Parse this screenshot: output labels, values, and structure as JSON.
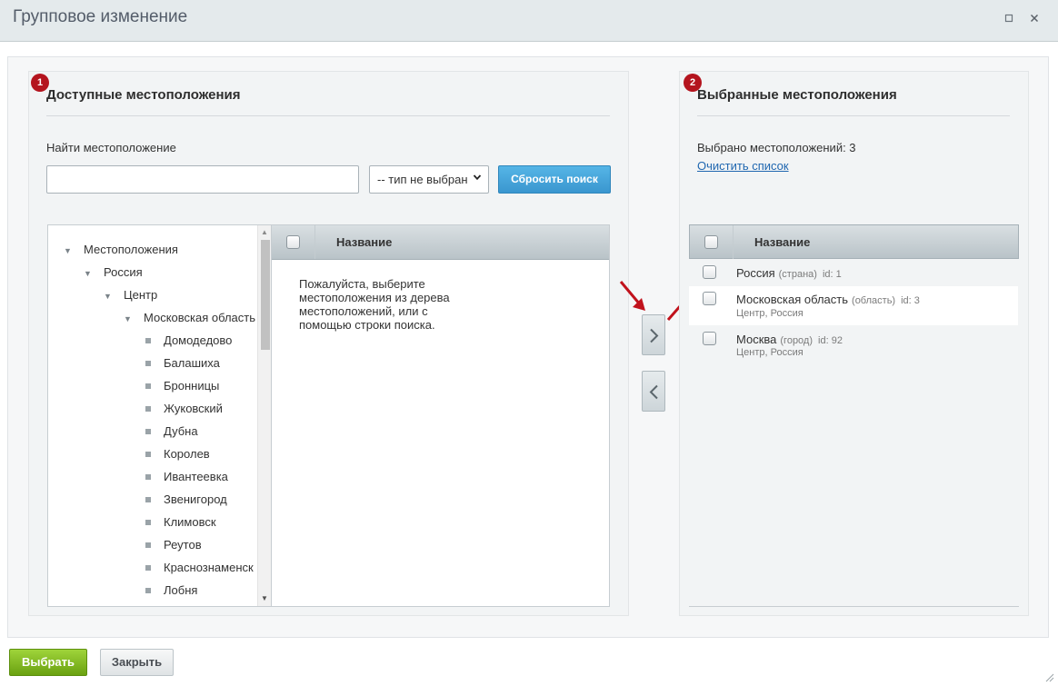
{
  "dialog": {
    "title": "Групповое изменение"
  },
  "available": {
    "badge": "1",
    "title": "Доступные местоположения",
    "search_label": "Найти местоположение",
    "search_value": "",
    "type_select": "-- тип не выбран",
    "reset_button": "Сбросить поиск",
    "tree": [
      {
        "label": "Местоположения",
        "level": 0,
        "kind": "folder"
      },
      {
        "label": "Россия",
        "level": 1,
        "kind": "folder"
      },
      {
        "label": "Центр",
        "level": 2,
        "kind": "folder"
      },
      {
        "label": "Московская область",
        "level": 3,
        "kind": "folder"
      },
      {
        "label": "Домодедово",
        "level": 4,
        "kind": "leaf"
      },
      {
        "label": "Балашиха",
        "level": 4,
        "kind": "leaf"
      },
      {
        "label": "Бронницы",
        "level": 4,
        "kind": "leaf"
      },
      {
        "label": "Жуковский",
        "level": 4,
        "kind": "leaf"
      },
      {
        "label": "Дубна",
        "level": 4,
        "kind": "leaf"
      },
      {
        "label": "Королев",
        "level": 4,
        "kind": "leaf"
      },
      {
        "label": "Ивантеевка",
        "level": 4,
        "kind": "leaf"
      },
      {
        "label": "Звенигород",
        "level": 4,
        "kind": "leaf"
      },
      {
        "label": "Климовск",
        "level": 4,
        "kind": "leaf"
      },
      {
        "label": "Реутов",
        "level": 4,
        "kind": "leaf"
      },
      {
        "label": "Краснознаменск",
        "level": 4,
        "kind": "leaf"
      },
      {
        "label": "Лобня",
        "level": 4,
        "kind": "leaf"
      }
    ],
    "grid_header": "Название",
    "placeholder": "Пожалуйста, выберите местоположения из дерева местоположений, или с помощью строки поиска."
  },
  "selected": {
    "badge": "2",
    "title": "Выбранные местоположения",
    "count_text": "Выбрано местоположений: 3",
    "clear_link": "Очистить список",
    "grid_header": "Название",
    "rows": [
      {
        "name": "Россия",
        "type": "(страна)",
        "id": "id: 1",
        "path": ""
      },
      {
        "name": "Московская область",
        "type": "(область)",
        "id": "id: 3",
        "path": "Центр, Россия"
      },
      {
        "name": "Москва",
        "type": "(город)",
        "id": "id: 92",
        "path": "Центр, Россия"
      }
    ]
  },
  "footer": {
    "select_button": "Выбрать",
    "close_button": "Закрыть"
  },
  "colors": {
    "accent_blue": "#3a96cf",
    "accent_green": "#6aa111",
    "badge_red": "#b4141e"
  }
}
